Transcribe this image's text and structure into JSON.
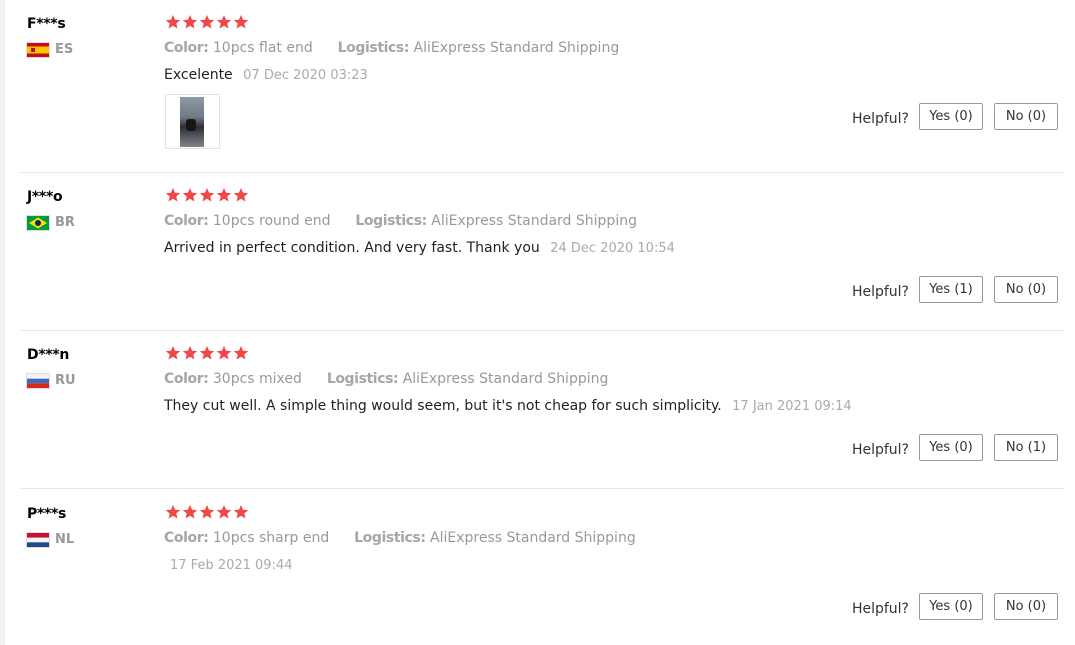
{
  "reviews": [
    {
      "user": "F***s",
      "country": "ES",
      "flag": "es",
      "color_label": "Color:",
      "color_value": "10pcs flat end",
      "logistics_label": "Logistics:",
      "logistics_value": "AliExpress Standard Shipping",
      "text": "Excelente",
      "date": "07 Dec 2020 03:23",
      "has_photo": true,
      "helpful_label": "Helpful?",
      "yes": "Yes (0)",
      "no": "No (0)",
      "rating": 5
    },
    {
      "user": "J***o",
      "country": "BR",
      "flag": "br",
      "color_label": "Color:",
      "color_value": "10pcs round end",
      "logistics_label": "Logistics:",
      "logistics_value": "AliExpress Standard Shipping",
      "text": "Arrived in perfect condition. And very fast. Thank you",
      "date": "24 Dec 2020 10:54",
      "has_photo": false,
      "helpful_label": "Helpful?",
      "yes": "Yes (1)",
      "no": "No (0)",
      "rating": 5
    },
    {
      "user": "D***n",
      "country": "RU",
      "flag": "ru",
      "color_label": "Color:",
      "color_value": "30pcs mixed",
      "logistics_label": "Logistics:",
      "logistics_value": "AliExpress Standard Shipping",
      "text": "They cut well. A simple thing would seem, but it's not cheap for such simplicity.",
      "date": "17 Jan 2021 09:14",
      "has_photo": false,
      "helpful_label": "Helpful?",
      "yes": "Yes (0)",
      "no": "No (1)",
      "rating": 5
    },
    {
      "user": "P***s",
      "country": "NL",
      "flag": "nl",
      "color_label": "Color:",
      "color_value": "10pcs sharp end",
      "logistics_label": "Logistics:",
      "logistics_value": "AliExpress Standard Shipping",
      "text": "",
      "date": "17 Feb 2021 09:44",
      "has_photo": false,
      "helpful_label": "Helpful?",
      "yes": "Yes (0)",
      "no": "No (0)",
      "rating": 5
    }
  ],
  "colors": {
    "star": "#f04848",
    "muted": "#999999",
    "divider": "#e8e8e8"
  }
}
